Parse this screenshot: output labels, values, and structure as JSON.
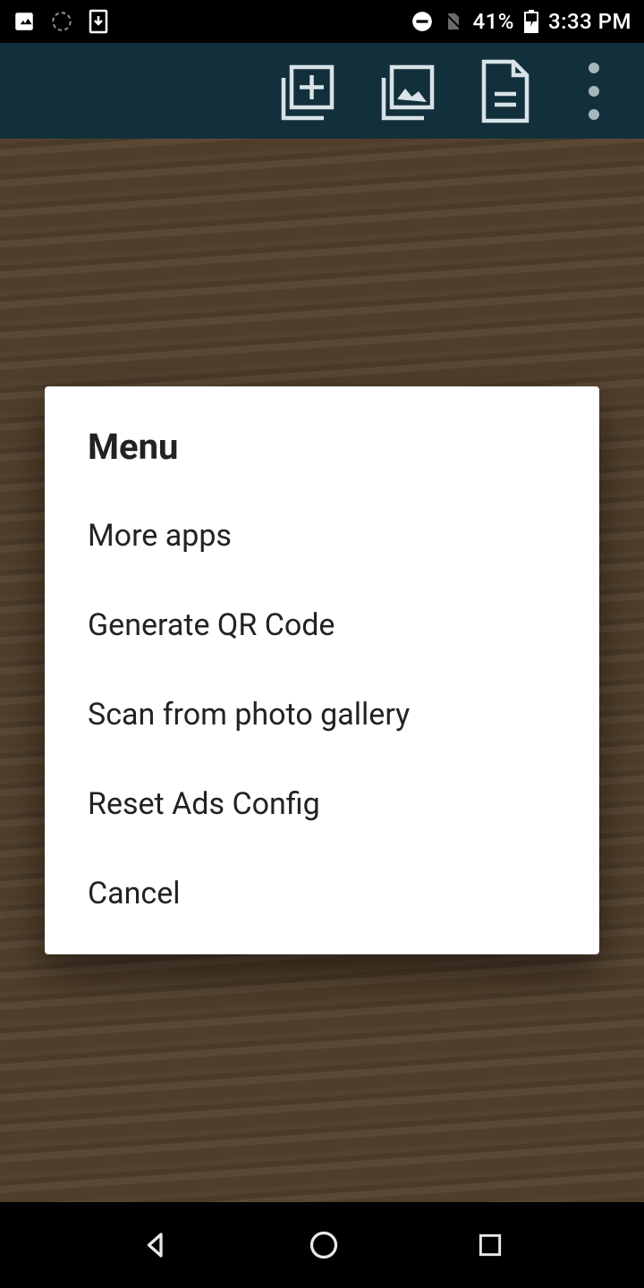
{
  "status": {
    "battery_pct": "41%",
    "time": "3:33 PM"
  },
  "dialog": {
    "title": "Menu",
    "items": [
      "More apps",
      "Generate QR Code",
      "Scan from photo gallery",
      "Reset Ads Config",
      "Cancel"
    ]
  }
}
